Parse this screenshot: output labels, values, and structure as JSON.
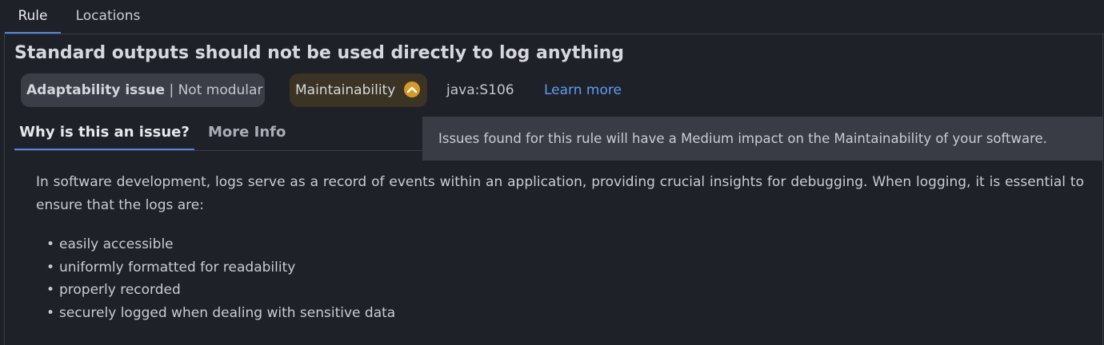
{
  "top_tabs": [
    {
      "label": "Rule",
      "active": true
    },
    {
      "label": "Locations",
      "active": false
    }
  ],
  "title": "Standard outputs should not be used directly to log anything",
  "chips": {
    "adaptability_strong": "Adaptability issue",
    "adaptability_sep": " | ",
    "adaptability_rest": "Not modular",
    "maintainability": "Maintainability",
    "impact_icon": "chevron-up-icon"
  },
  "rule_key": "java:S106",
  "learn_more": "Learn more",
  "inner_tabs": [
    {
      "label": "Why is this an issue?",
      "active": true
    },
    {
      "label": "More Info",
      "active": false
    }
  ],
  "tooltip": "Issues found for this rule will have a Medium impact on the Maintainability of your software.",
  "body": {
    "paragraph": "In software development, logs serve as a record of events within an application, providing crucial insights for debugging. When logging, it is essential to ensure that the logs are:",
    "bullet_glyph": "•",
    "bullets": [
      "easily accessible",
      "uniformly formatted for readability",
      "properly recorded",
      "securely logged when dealing with sensitive data"
    ]
  },
  "colors": {
    "background": "#1f2129",
    "accent": "#4f86d8",
    "link": "#5f9cf0",
    "impact_medium": "#d49a2a"
  }
}
